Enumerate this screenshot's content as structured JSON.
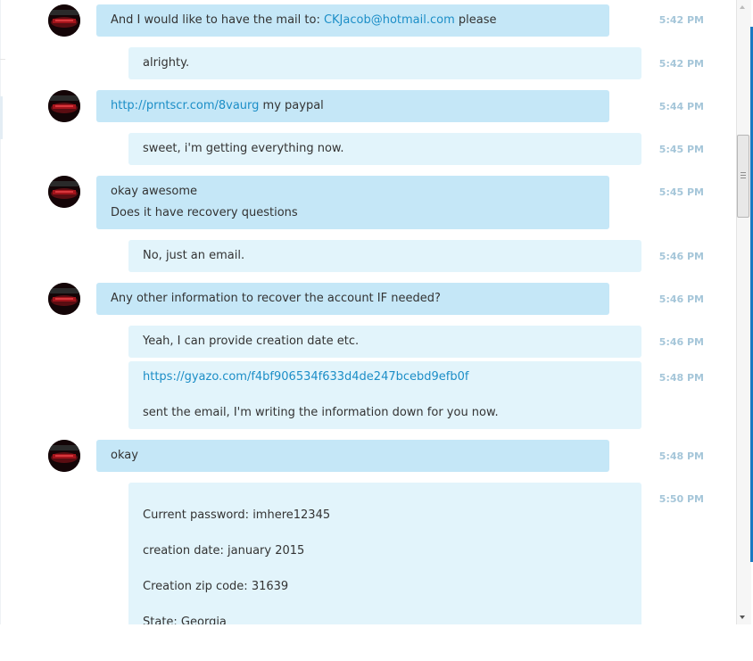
{
  "contact": {
    "avatar_icon": "contact-avatar-icon"
  },
  "messages": [
    {
      "direction": "in",
      "time": "5:42 PM",
      "parts": [
        {
          "text": "And I would like to have the mail to: "
        },
        {
          "text": "CKJacob@hotmail.com",
          "link": true
        },
        {
          "text": " please"
        }
      ]
    },
    {
      "direction": "out",
      "time": "5:42 PM",
      "text": "alrighty."
    },
    {
      "direction": "in",
      "time": "5:44 PM",
      "parts": [
        {
          "text": "http://prntscr.com/8vaurg",
          "link": true
        },
        {
          "text": " my paypal"
        }
      ]
    },
    {
      "direction": "out",
      "time": "5:45 PM",
      "text": "sweet, i'm getting everything now."
    },
    {
      "direction": "in",
      "time": "5:45 PM",
      "lines": [
        "okay awesome",
        "Does it have recovery questions"
      ]
    },
    {
      "direction": "out",
      "time": "5:46 PM",
      "text": "No, just an email."
    },
    {
      "direction": "in",
      "time": "5:46 PM",
      "text": "Any other information to recover the account IF needed?"
    },
    {
      "direction": "out",
      "time": "5:46 PM",
      "text": "Yeah, I can provide creation date etc."
    },
    {
      "direction": "out",
      "time": "5:48 PM",
      "link": "https://gyazo.com/f4bf906534f633d4de247bcebd9efb0f",
      "text": "sent the email, I'm writing the information down for you now."
    },
    {
      "direction": "in",
      "time": "5:48 PM",
      "text": "okay"
    },
    {
      "direction": "out",
      "time": "5:50 PM",
      "lines": [
        "Current password: imhere12345",
        "creation date: january 2015",
        "Creation zip code: 31639",
        "State: Georgia"
      ]
    }
  ],
  "colors": {
    "incoming_bubble": "#c5e7f7",
    "outgoing_bubble": "#e2f4fb",
    "link": "#1c8ec7",
    "timestamp": "#a5c6d9",
    "scroll_accent": "#1a79c2"
  }
}
